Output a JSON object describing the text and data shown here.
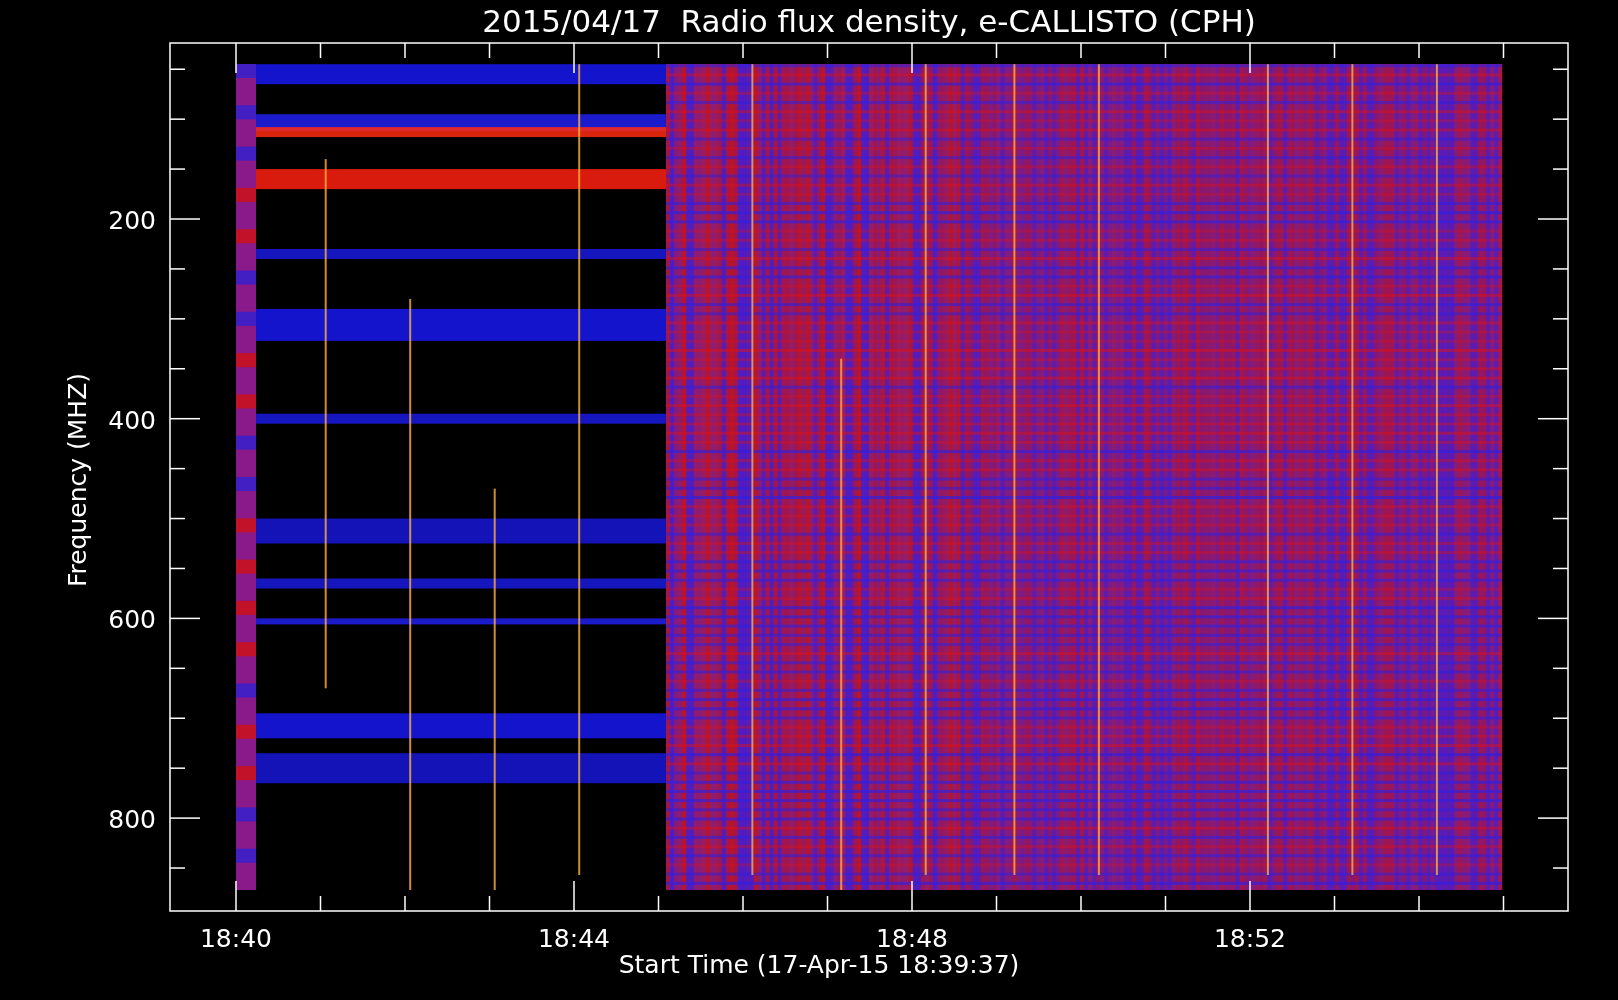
{
  "title": "2015/04/17  Radio flux density, e-CALLISTO (CPH)",
  "y_axis": {
    "title": "Frequency (MHZ)",
    "tick_labels": [
      "200",
      "400",
      "600",
      "800"
    ]
  },
  "x_axis": {
    "title": "Start Time (17-Apr-15 18:39:37)",
    "tick_labels": [
      "18:40",
      "18:44",
      "18:48",
      "18:52"
    ]
  }
}
